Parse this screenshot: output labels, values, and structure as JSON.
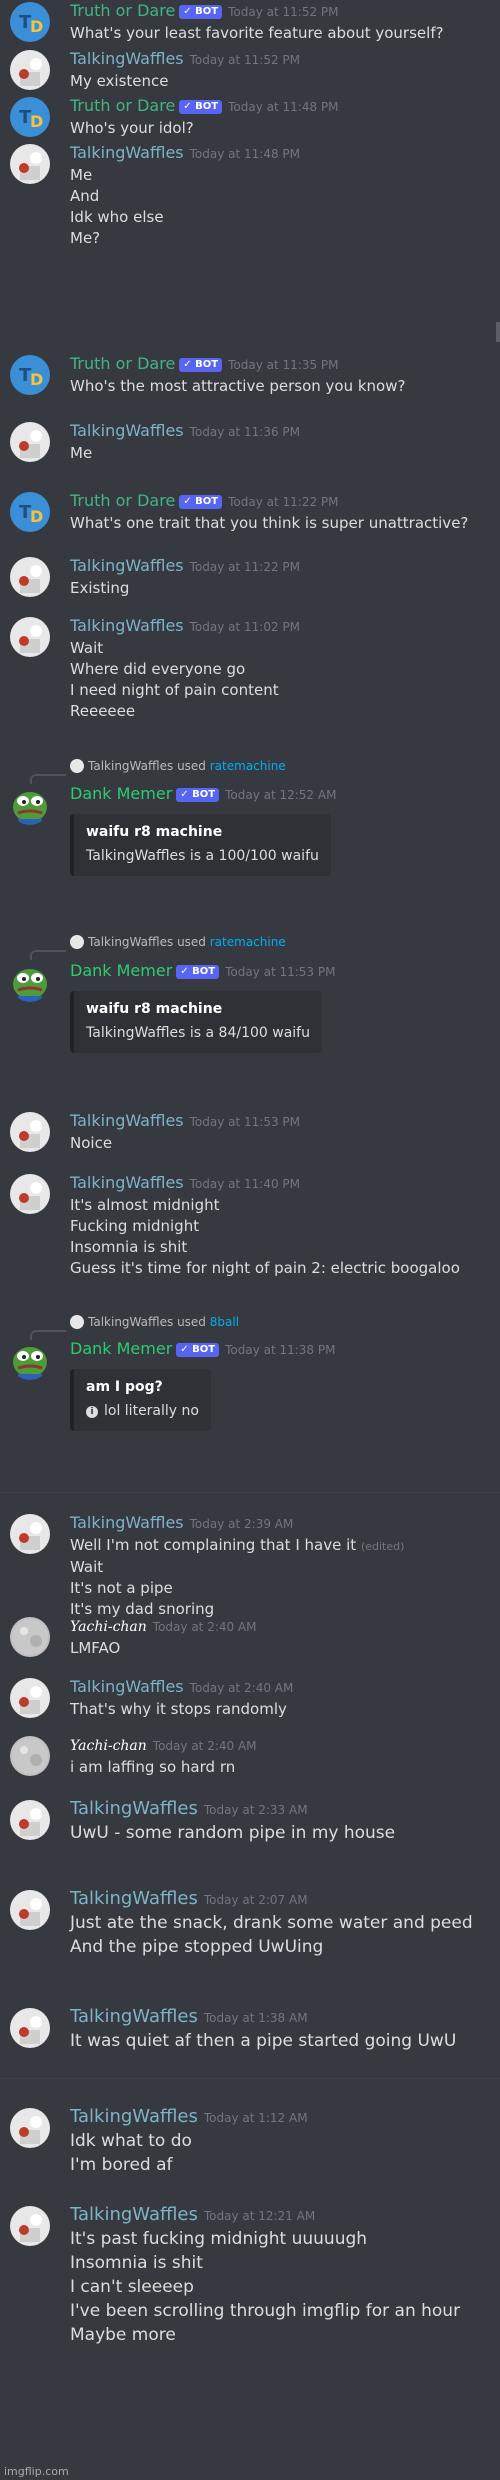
{
  "users": {
    "truth_or_dare": "Truth or Dare",
    "talking_waffles": "TalkingWaffles",
    "dank_memer": "Dank Memer",
    "yachi": "Yachi-chan"
  },
  "bot_badge": "✓ BOT",
  "used_word": "used",
  "edited_label": "(edited)",
  "messages": [
    {
      "ts": "Today at 11:52 PM",
      "lines": [
        "What's your least favorite feature about yourself?"
      ]
    },
    {
      "ts": "Today at 11:52 PM",
      "lines": [
        "My existence"
      ]
    },
    {
      "ts": "Today at 11:48 PM",
      "lines": [
        "Who's your idol?"
      ]
    },
    {
      "ts": "Today at 11:48 PM",
      "lines": [
        "Me",
        "And",
        "Idk who else",
        "Me?"
      ]
    },
    {
      "ts": "Today at 11:35 PM",
      "lines": [
        "Who's the most attractive person you know?"
      ]
    },
    {
      "ts": "Today at 11:36 PM",
      "lines": [
        "Me"
      ]
    },
    {
      "ts": "Today at 11:22 PM",
      "lines": [
        "What's one trait that you think is super unattractive?"
      ]
    },
    {
      "ts": "Today at 11:22 PM",
      "lines": [
        "Existing"
      ]
    },
    {
      "ts": "Today at 11:02 PM",
      "lines": [
        "Wait",
        "Where did everyone go",
        "I need night of pain content",
        "Reeeeee"
      ]
    },
    {
      "ts": "Today at 12:52 AM",
      "reply_cmd": "ratemachine",
      "embed_title": "waifu r8 machine",
      "embed_desc": "TalkingWaffles is a 100/100 waifu"
    },
    {
      "ts": "Today at 11:53 PM",
      "reply_cmd": "ratemachine",
      "embed_title": "waifu r8 machine",
      "embed_desc": "TalkingWaffles is a 84/100 waifu"
    },
    {
      "ts": "Today at 11:53 PM",
      "lines": [
        "Noice"
      ]
    },
    {
      "ts": "Today at 11:40 PM",
      "lines": [
        "It's almost midnight",
        "Fucking midnight",
        "Insomnia is shit",
        "Guess it's time for night of pain 2: electric boogaloo"
      ]
    },
    {
      "ts": "Today at 11:38 PM",
      "reply_cmd": "8ball",
      "embed_title": "am I pog?",
      "embed_desc": "lol literally no"
    },
    {
      "ts": "Today at 2:39 AM",
      "lines": [
        "Well I'm not complaining that I have it",
        "Wait",
        "It's not a pipe",
        "It's my dad snoring"
      ]
    },
    {
      "ts": "Today at 2:40 AM",
      "lines": [
        "LMFAO"
      ]
    },
    {
      "ts": "Today at 2:40 AM",
      "lines": [
        "That's why it stops randomly"
      ]
    },
    {
      "ts": "Today at 2:40 AM",
      "lines": [
        "i am laffing so hard rn"
      ]
    },
    {
      "ts": "Today at 2:33 AM",
      "lines": [
        "UwU - some random pipe in my house"
      ]
    },
    {
      "ts": "Today at 2:07 AM",
      "lines": [
        "Just ate the snack, drank some water and peed",
        "And the pipe stopped UwUing"
      ]
    },
    {
      "ts": "Today at 1:38 AM",
      "lines": [
        "It was quiet af then a pipe started going UwU"
      ]
    },
    {
      "ts": "Today at 1:12 AM",
      "lines": [
        "Idk what to do",
        "I'm bored af"
      ]
    },
    {
      "ts": "Today at 12:21 AM",
      "lines": [
        "It's past fucking midnight uuuuugh",
        "Insomnia is shit",
        "I can't sleeeep",
        "I've been scrolling through imgflip for an hour",
        "Maybe more"
      ]
    }
  ],
  "watermark": "imgflip.com",
  "colors": {
    "background": "#36393f",
    "bot_badge": "#5865f2",
    "bot_name": "#43b581",
    "user_name": "#7fb3c6",
    "link": "#00aff4"
  }
}
